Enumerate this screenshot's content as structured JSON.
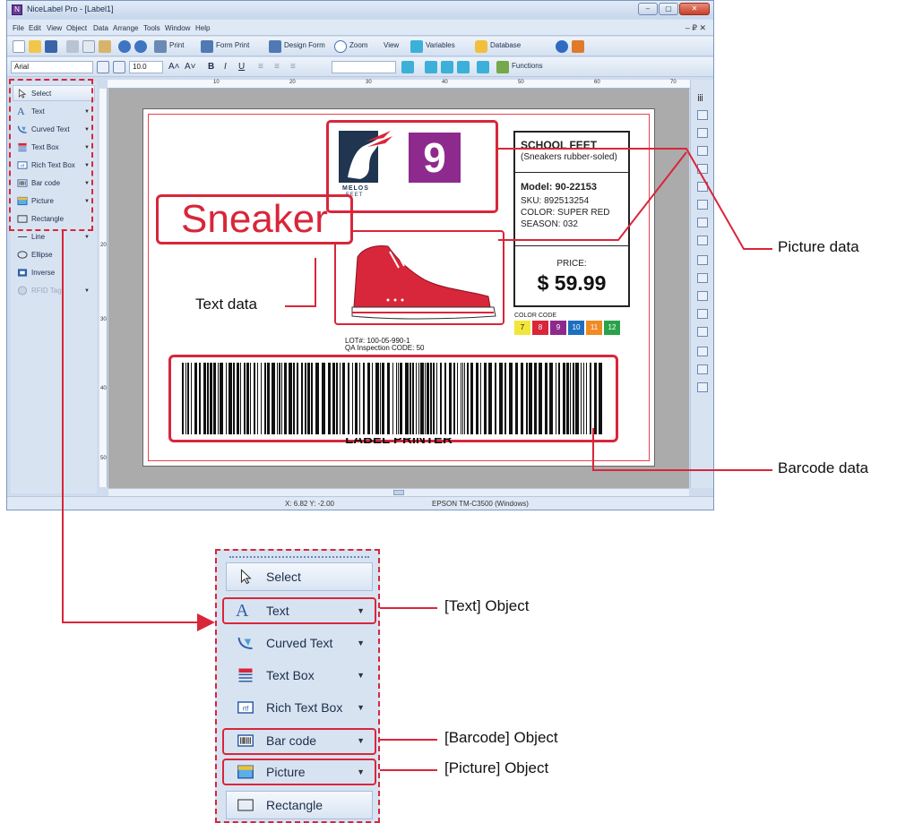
{
  "window": {
    "title": "NiceLabel Pro - [Label1]",
    "app_icon": "nicelabel-icon",
    "controls": [
      "–",
      "▢",
      "✕"
    ],
    "mdi_controls": "– ₽ ✕"
  },
  "menu": [
    "File",
    "Edit",
    "View",
    "Object",
    "Data",
    "Arrange",
    "Tools",
    "Window",
    "Help"
  ],
  "toolbar1": {
    "print": "Print",
    "form_print": "Form Print",
    "design_form": "Design Form",
    "zoom": "Zoom",
    "view": "View",
    "variables": "Variables",
    "database": "Database"
  },
  "toolbar2": {
    "font": "Arial",
    "size": "10.0",
    "functions": "Functions"
  },
  "ruler": {
    "h": [
      "10",
      "20",
      "30",
      "40",
      "50",
      "60",
      "70"
    ],
    "v": [
      "20",
      "30",
      "40",
      "50"
    ]
  },
  "toolbox": [
    {
      "label": "Select",
      "icon": "cursor-icon",
      "arrow": false
    },
    {
      "label": "Text",
      "icon": "text-a-icon",
      "arrow": true
    },
    {
      "label": "Curved Text",
      "icon": "curved-text-icon",
      "arrow": true
    },
    {
      "label": "Text Box",
      "icon": "text-box-icon",
      "arrow": true
    },
    {
      "label": "Rich Text Box",
      "icon": "rich-text-icon",
      "arrow": true
    },
    {
      "label": "Bar code",
      "icon": "barcode-icon",
      "arrow": true
    },
    {
      "label": "Picture",
      "icon": "picture-icon",
      "arrow": true
    },
    {
      "label": "Rectangle",
      "icon": "rectangle-icon",
      "arrow": false
    }
  ],
  "toolbox_extra": [
    {
      "label": "Line",
      "icon": "line-icon"
    },
    {
      "label": "Ellipse",
      "icon": "ellipse-icon"
    },
    {
      "label": "Inverse",
      "icon": "inverse-icon"
    },
    {
      "label": "RFID Tag",
      "icon": "rfid-icon"
    }
  ],
  "label": {
    "logo_text": "MELOS",
    "logo_sub": "FEET",
    "badge_number": "9",
    "headline": "Sneaker",
    "brand": "SCHOOL FEET",
    "brand_sub": "(Sneakers rubber-soled)",
    "model": "Model: 90-22153",
    "sku": "SKU: 892513254",
    "color": "COLOR: SUPER RED",
    "season": "SEASON: 032",
    "price_label": "PRICE:",
    "price": "$ 59.99",
    "color_code_title": "COLOR CODE",
    "color_codes": [
      {
        "n": "7",
        "c": "#f2e63a"
      },
      {
        "n": "8",
        "c": "#d8263a"
      },
      {
        "n": "9",
        "c": "#8e2a8e"
      },
      {
        "n": "10",
        "c": "#1f6fbf"
      },
      {
        "n": "11",
        "c": "#f08a24"
      },
      {
        "n": "12",
        "c": "#2aa24a"
      }
    ],
    "lot": "LOT#: 100-05-990-1",
    "inspection": "QA Inspection CODE: 50",
    "footer": "LABEL PRINTER"
  },
  "status": {
    "coords": "X: 6.82 Y: -2.00",
    "printer": "EPSON TM-C3500 (Windows)"
  },
  "callouts": {
    "picture_data": "Picture data",
    "text_data": "Text data",
    "barcode_data": "Barcode data",
    "text_object": "[Text] Object",
    "barcode_object": "[Barcode] Object",
    "picture_object": "[Picture] Object"
  },
  "colors": {
    "accent": "#d8263a",
    "purple": "#8e2a8e",
    "logo_navy": "#1f3550"
  }
}
